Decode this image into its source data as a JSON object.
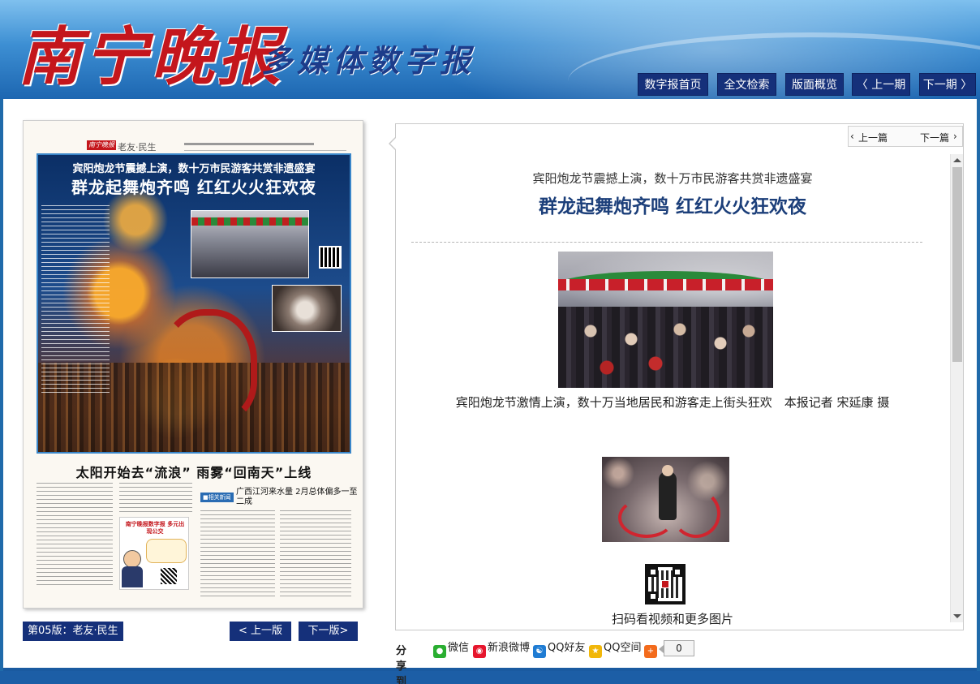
{
  "header": {
    "masthead": "南宁晚报",
    "subtitle": "多媒体数字报",
    "nav": [
      {
        "label": "数字报首页"
      },
      {
        "label": "全文检索"
      },
      {
        "label": "版面概览"
      },
      {
        "label": "〈 上一期"
      },
      {
        "label": "下一期 〉"
      }
    ]
  },
  "paper_page": {
    "section_label": "老友·民生",
    "kicker": "宾阳炮龙节震撼上演，数十万市民游客共赏非遗盛宴",
    "headline": "群龙起舞炮齐鸣  红红火火狂欢夜",
    "headline2": "太阳开始去“流浪”  雨雾“回南天”上线",
    "related_tag": "■相关新闻",
    "related_title": "广西江河来水量 2月总体偏多一至二成",
    "ad_title": "南宁晚报数字报 多元出现公交"
  },
  "page_nav": {
    "current_page": "第05版：老友·民生",
    "prev_label": "< 上一版",
    "next_label": "下一版>"
  },
  "article": {
    "prev_article": "上一篇",
    "next_article": "下一篇",
    "kicker": "宾阳炮龙节震撼上演，数十万市民游客共赏非遗盛宴",
    "title": "群龙起舞炮齐鸣 红红火火狂欢夜",
    "caption1": "宾阳炮龙节激情上演，数十万当地居民和游客走上街头狂欢　本报记者  宋延康 摄",
    "caption2": "扫码看视频和更多图片"
  },
  "share": {
    "label": "分享到",
    "items": [
      {
        "label": "微信",
        "icon": "wechat-icon",
        "color": "#2aae31"
      },
      {
        "label": "新浪微博",
        "icon": "weibo-icon",
        "color": "#e6162d"
      },
      {
        "label": "QQ好友",
        "icon": "qq-icon",
        "color": "#1f7cd3"
      },
      {
        "label": "QQ空间",
        "icon": "qzone-icon",
        "color": "#f1b70a"
      }
    ],
    "count": "0"
  },
  "colors": {
    "nav_bg": "#15307a",
    "title_blue": "#1c3f7a",
    "masthead_red": "#c4161c"
  }
}
